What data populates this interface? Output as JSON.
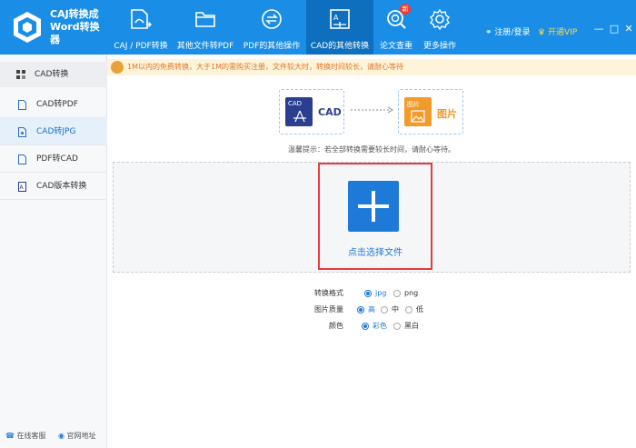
{
  "app": {
    "title_line1": "CAJ转换成",
    "title_line2": "Word转换",
    "title_line3": "器"
  },
  "nav": [
    {
      "label": "CAJ / PDF转换"
    },
    {
      "label": "其他文件转PDF"
    },
    {
      "label": "PDF的其他操作"
    },
    {
      "label": "CAD的其他转换"
    },
    {
      "label": "论文查重",
      "badge": "新"
    },
    {
      "label": "更多操作"
    }
  ],
  "header": {
    "login": "注册/登录",
    "vip": "开通VIP",
    "minimize": "—",
    "maximize": "□",
    "close": "✕"
  },
  "sidebar": {
    "heading": "CAD转换",
    "items": [
      {
        "label": "CAD转PDF"
      },
      {
        "label": "CAD转JPG"
      },
      {
        "label": "PDF转CAD"
      },
      {
        "label": "CAD版本转换"
      }
    ],
    "footer_service": "在线客服",
    "footer_site": "官网地址"
  },
  "notice": {
    "text": "1M以内的免费转换，大于1M的需购买注册，文件较大时，转换时间较长，请耐心等待"
  },
  "conversion": {
    "from_icon_text": "CAD",
    "from_label": "CAD",
    "to_icon_text": "图片",
    "to_label": "图片"
  },
  "tip": {
    "text": "温馨提示：若全部转换需要较长时间，请耐心等待。"
  },
  "drop": {
    "label": "点击选择文件"
  },
  "options": {
    "format": {
      "label": "转换格式",
      "choices": [
        "jpg",
        "png"
      ],
      "selected": "jpg"
    },
    "quality": {
      "label": "图片质量",
      "choices": [
        "高",
        "中",
        "低"
      ],
      "selected": "高"
    },
    "color": {
      "label": "颜色",
      "choices": [
        "彩色",
        "黑白"
      ],
      "selected": "彩色"
    }
  },
  "colors": {
    "header": "#1a8ee6",
    "active_nav": "#0d6fbd",
    "accent": "#1e7ad9",
    "highlight_border": "#e23d3d",
    "notice_text": "#e0762a"
  }
}
